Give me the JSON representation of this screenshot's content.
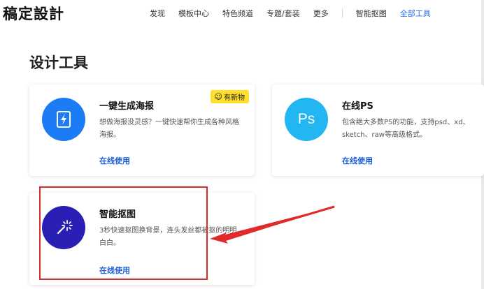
{
  "header": {
    "logo": "稿定設計",
    "nav": [
      {
        "label": "发现"
      },
      {
        "label": "模板中心"
      },
      {
        "label": "特色频道"
      },
      {
        "label": "专题/套装"
      },
      {
        "label": "更多"
      },
      {
        "label": "智能抠图"
      },
      {
        "label": "全部工具",
        "active": true
      }
    ]
  },
  "page_title": "设计工具",
  "cards": [
    {
      "title": "一键生成海报",
      "description": "想做海报没灵感？一键快速帮你生成各种风格海报。",
      "link": "在线使用",
      "badge": "有新物",
      "icon": "lightning-card-icon",
      "icon_color": "#1b7cf5"
    },
    {
      "title": "在线PS",
      "description": "包含绝大多数PS的功能，支持psd、xd、sketch、raw等高级格式。",
      "link": "在线使用",
      "icon": "ps-icon",
      "icon_text": "Ps",
      "icon_color": "#22b6f2"
    },
    {
      "title": "智能抠图",
      "description": "3秒快速抠图换背景，连头发丝都被抠的明明白白。",
      "link": "在线使用",
      "icon": "magic-wand-icon",
      "icon_color": "#2a1fb5"
    }
  ],
  "colors": {
    "accent": "#1b6bf0",
    "link": "#1b5fd9",
    "badge": "#ffdf2b",
    "annotation": "#e02b2b"
  }
}
